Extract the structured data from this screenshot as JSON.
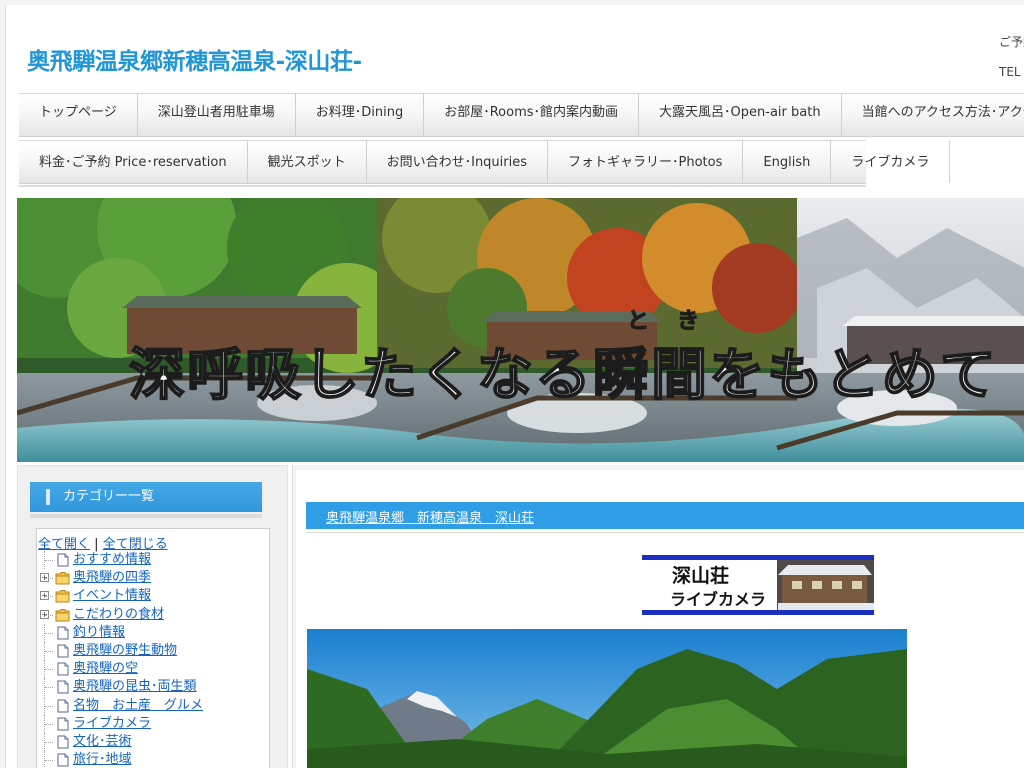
{
  "header": {
    "site_title": "奥飛騨温泉郷新穂高温泉-深山荘-",
    "contact_line1": "ご予約",
    "contact_line2": "TEL"
  },
  "nav": {
    "row1": [
      "トップページ",
      "深山登山者用駐車場",
      "お料理･Dining",
      "お部屋･Rooms･館内案内動画",
      "大露天風呂･Open-air bath",
      "当館へのアクセス方法･アクセス動画"
    ],
    "row2": [
      "料金･ご予約 Price･reservation",
      "観光スポット",
      "お問い合わせ･Inquiries",
      "フォトギャラリー･Photos",
      "English",
      "ライブカメラ"
    ]
  },
  "hero": {
    "tagline": "深呼吸したくなる瞬間をもとめて",
    "ruby_to": "と",
    "ruby_ki": "き"
  },
  "sidebar": {
    "category_title": "カテゴリー一覧",
    "open_all": "全て開く",
    "separator": "|",
    "close_all": "全て閉じる",
    "items": [
      {
        "label": "おすすめ情報",
        "type": "page"
      },
      {
        "label": "奥飛騨の四季",
        "type": "folder"
      },
      {
        "label": "イベント情報",
        "type": "folder"
      },
      {
        "label": "こだわりの食材",
        "type": "folder"
      },
      {
        "label": "釣り情報",
        "type": "page"
      },
      {
        "label": "奥飛騨の野生動物",
        "type": "page"
      },
      {
        "label": "奥飛騨の空",
        "type": "page"
      },
      {
        "label": "奥飛騨の昆虫･両生類",
        "type": "page"
      },
      {
        "label": "名物　お土産　グルメ",
        "type": "page"
      },
      {
        "label": "ライブカメラ",
        "type": "page"
      },
      {
        "label": "文化･芸術",
        "type": "page"
      },
      {
        "label": "旅行･地域",
        "type": "page"
      }
    ]
  },
  "main": {
    "title": "奥飛騨温泉郷　新穂高温泉　深山荘",
    "live_banner_line1": "深山荘",
    "live_banner_line2": "ライブカメラ"
  },
  "colors": {
    "accent": "#2f9ee6",
    "title_blue": "#2196d6",
    "link_blue": "#1565c0"
  }
}
